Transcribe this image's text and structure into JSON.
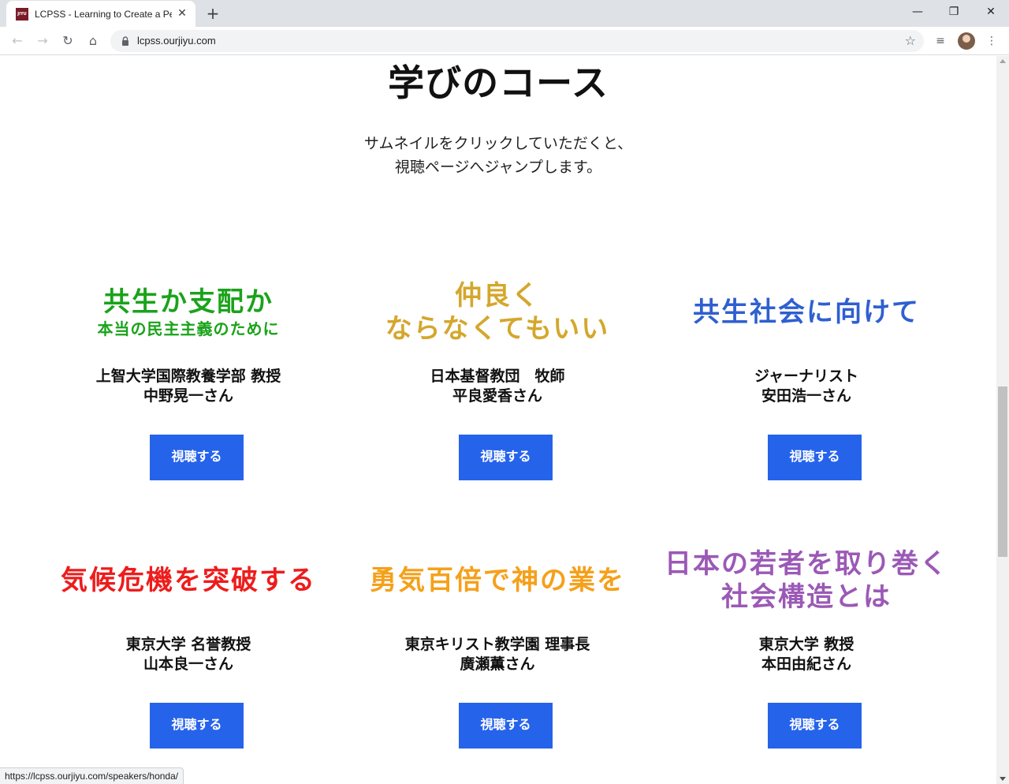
{
  "browser": {
    "tab": {
      "favicon_text": "JIYU",
      "title": "LCPSS - Learning to Create a Pea"
    },
    "address": "lcpss.ourjiyu.com",
    "status_url": "https://lcpss.ourjiyu.com/speakers/honda/"
  },
  "page": {
    "title": "学びのコース",
    "lead_line1": "サムネイルをクリックしていただくと、",
    "lead_line2": "視聴ページへジャンプします。"
  },
  "courses": [
    {
      "thumb_line1": "共生か支配か",
      "thumb_line2": "本当の民主主義のために",
      "thumb_color": "#1aa31a",
      "speaker_line1": "上智大学国際教養学部 教授",
      "speaker_line2": "中野晃一さん",
      "button": "視聴する"
    },
    {
      "thumb_line1": "仲良く",
      "thumb_line2": "ならなくてもいい",
      "thumb_color": "#d4a72c",
      "speaker_line1": "日本基督教団　牧師",
      "speaker_line2": "平良愛香さん",
      "button": "視聴する"
    },
    {
      "thumb_line1": "共生社会に向けて",
      "thumb_line2": "",
      "thumb_color": "#2f5fd0",
      "speaker_line1": "ジャーナリスト",
      "speaker_line2": "安田浩一さん",
      "button": "視聴する"
    },
    {
      "thumb_line1": "気候危機を突破する",
      "thumb_line2": "",
      "thumb_color": "#ee1c1c",
      "speaker_line1": "東京大学 名誉教授",
      "speaker_line2": "山本良一さん",
      "button": "視聴する"
    },
    {
      "thumb_line1": "勇気百倍で神の業を",
      "thumb_line2": "",
      "thumb_color": "#f5a01a",
      "speaker_line1": "東京キリスト教学園 理事長",
      "speaker_line2": "廣瀬薫さん",
      "button": "視聴する"
    },
    {
      "thumb_line1": "日本の若者を取り巻く",
      "thumb_line2": "社会構造とは",
      "thumb_color": "#9b59b6",
      "speaker_line1": "東京大学 教授",
      "speaker_line2": "本田由紀さん",
      "button": "視聴する"
    }
  ],
  "accent_color": "#2563eb"
}
